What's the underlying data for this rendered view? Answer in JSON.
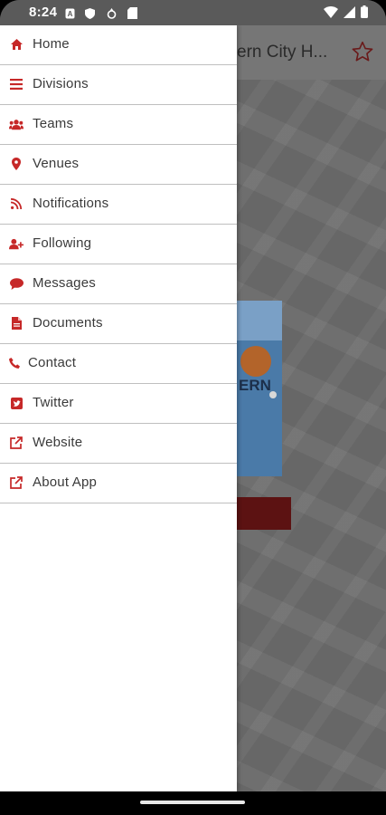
{
  "status_bar": {
    "time": "8:24"
  },
  "background_app": {
    "title": "ern City H...",
    "poster_text": "ERN"
  },
  "drawer": {
    "items": [
      {
        "label": "Home",
        "icon": "home-icon"
      },
      {
        "label": "Divisions",
        "icon": "list-icon"
      },
      {
        "label": "Teams",
        "icon": "users-icon"
      },
      {
        "label": "Venues",
        "icon": "map-pin-icon"
      },
      {
        "label": "Notifications",
        "icon": "rss-icon"
      },
      {
        "label": "Following",
        "icon": "user-plus-icon"
      },
      {
        "label": "Messages",
        "icon": "chat-bubble-icon"
      },
      {
        "label": "Documents",
        "icon": "document-icon"
      },
      {
        "label": "Contact",
        "icon": "phone-icon"
      },
      {
        "label": "Twitter",
        "icon": "twitter-icon"
      },
      {
        "label": "Website",
        "icon": "external-link-icon"
      },
      {
        "label": "About App",
        "icon": "external-link-icon"
      }
    ]
  },
  "colors": {
    "accent": "#c62828",
    "drawer_background": "#ffffff",
    "scrim": "#6f6f6f"
  }
}
